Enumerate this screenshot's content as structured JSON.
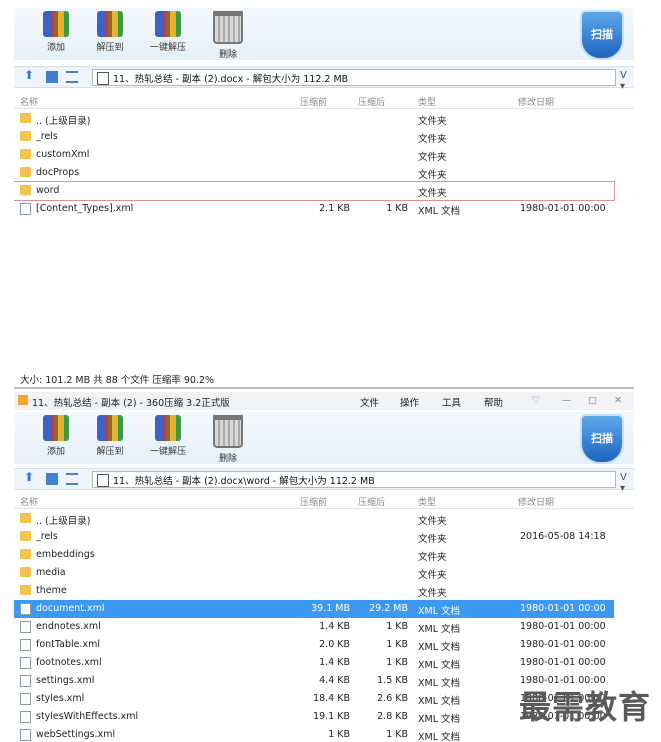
{
  "toolbar": {
    "buttons": [
      {
        "label": "添加",
        "icon": "add-archive-icon"
      },
      {
        "label": "解压到",
        "icon": "extract-to-icon"
      },
      {
        "label": "一键解压",
        "icon": "one-click-extract-icon"
      },
      {
        "label": "删除",
        "icon": "trash-icon"
      }
    ],
    "scan_label": "扫描"
  },
  "columns": {
    "name": "名称",
    "packed": "压缩前",
    "unpacked": "压缩后",
    "type": "类型",
    "modified": "修改日期"
  },
  "top_window": {
    "path": "11、热轧总结 - 副本 (2).docx - 解包大小为 112.2 MB",
    "rows": [
      {
        "name": ".. (上级目录)",
        "type": "文件夹",
        "kind": "folder"
      },
      {
        "name": "_rels",
        "type": "文件夹",
        "kind": "folder"
      },
      {
        "name": "customXml",
        "type": "文件夹",
        "kind": "folder"
      },
      {
        "name": "docProps",
        "type": "文件夹",
        "kind": "folder"
      },
      {
        "name": "word",
        "type": "文件夹",
        "kind": "folder",
        "highlighted": true
      },
      {
        "name": "[Content_Types].xml",
        "packed": "2.1 KB",
        "unpacked": "1 KB",
        "type": "XML 文档",
        "date": "1980-01-01 00:00",
        "kind": "file"
      }
    ],
    "status": "大小: 101.2 MB 共 88 个文件 压缩率 90.2%"
  },
  "bottom_window": {
    "title": "11、热轧总结 - 副本 (2) - 360压缩 3.2正式版",
    "menu": [
      "文件",
      "操作",
      "工具",
      "帮助"
    ],
    "path": "11、热轧总结 - 副本 (2).docx\\word - 解包大小为 112.2 MB",
    "rows": [
      {
        "name": ".. (上级目录)",
        "type": "文件夹",
        "kind": "folder"
      },
      {
        "name": "_rels",
        "type": "文件夹",
        "date": "2016-05-08 14:18",
        "kind": "folder"
      },
      {
        "name": "embeddings",
        "type": "文件夹",
        "kind": "folder"
      },
      {
        "name": "media",
        "type": "文件夹",
        "kind": "folder"
      },
      {
        "name": "theme",
        "type": "文件夹",
        "kind": "folder"
      },
      {
        "name": "document.xml",
        "packed": "39.1 MB",
        "unpacked": "29.2 MB",
        "type": "XML 文档",
        "date": "1980-01-01 00:00",
        "kind": "file",
        "selected": true
      },
      {
        "name": "endnotes.xml",
        "packed": "1.4 KB",
        "unpacked": "1 KB",
        "type": "XML 文档",
        "date": "1980-01-01 00:00",
        "kind": "file"
      },
      {
        "name": "fontTable.xml",
        "packed": "2.0 KB",
        "unpacked": "1 KB",
        "type": "XML 文档",
        "date": "1980-01-01 00:00",
        "kind": "file"
      },
      {
        "name": "footnotes.xml",
        "packed": "1.4 KB",
        "unpacked": "1 KB",
        "type": "XML 文档",
        "date": "1980-01-01 00:00",
        "kind": "file"
      },
      {
        "name": "settings.xml",
        "packed": "4.4 KB",
        "unpacked": "1.5 KB",
        "type": "XML 文档",
        "date": "1980-01-01 00:00",
        "kind": "file"
      },
      {
        "name": "styles.xml",
        "packed": "18.4 KB",
        "unpacked": "2.6 KB",
        "type": "XML 文档",
        "date": "1980-01-01 00:00",
        "kind": "file"
      },
      {
        "name": "stylesWithEffects.xml",
        "packed": "19.1 KB",
        "unpacked": "2.8 KB",
        "type": "XML 文档",
        "date": "1980-01-01 00:00",
        "kind": "file"
      },
      {
        "name": "webSettings.xml",
        "packed": "1 KB",
        "unpacked": "1 KB",
        "type": "XML 文档",
        "kind": "file"
      }
    ]
  },
  "watermark": "最需教育",
  "colors": {
    "selection": "#3c98f0",
    "highlight_outline": "#e38f8f",
    "folder": "#f2c34e"
  }
}
